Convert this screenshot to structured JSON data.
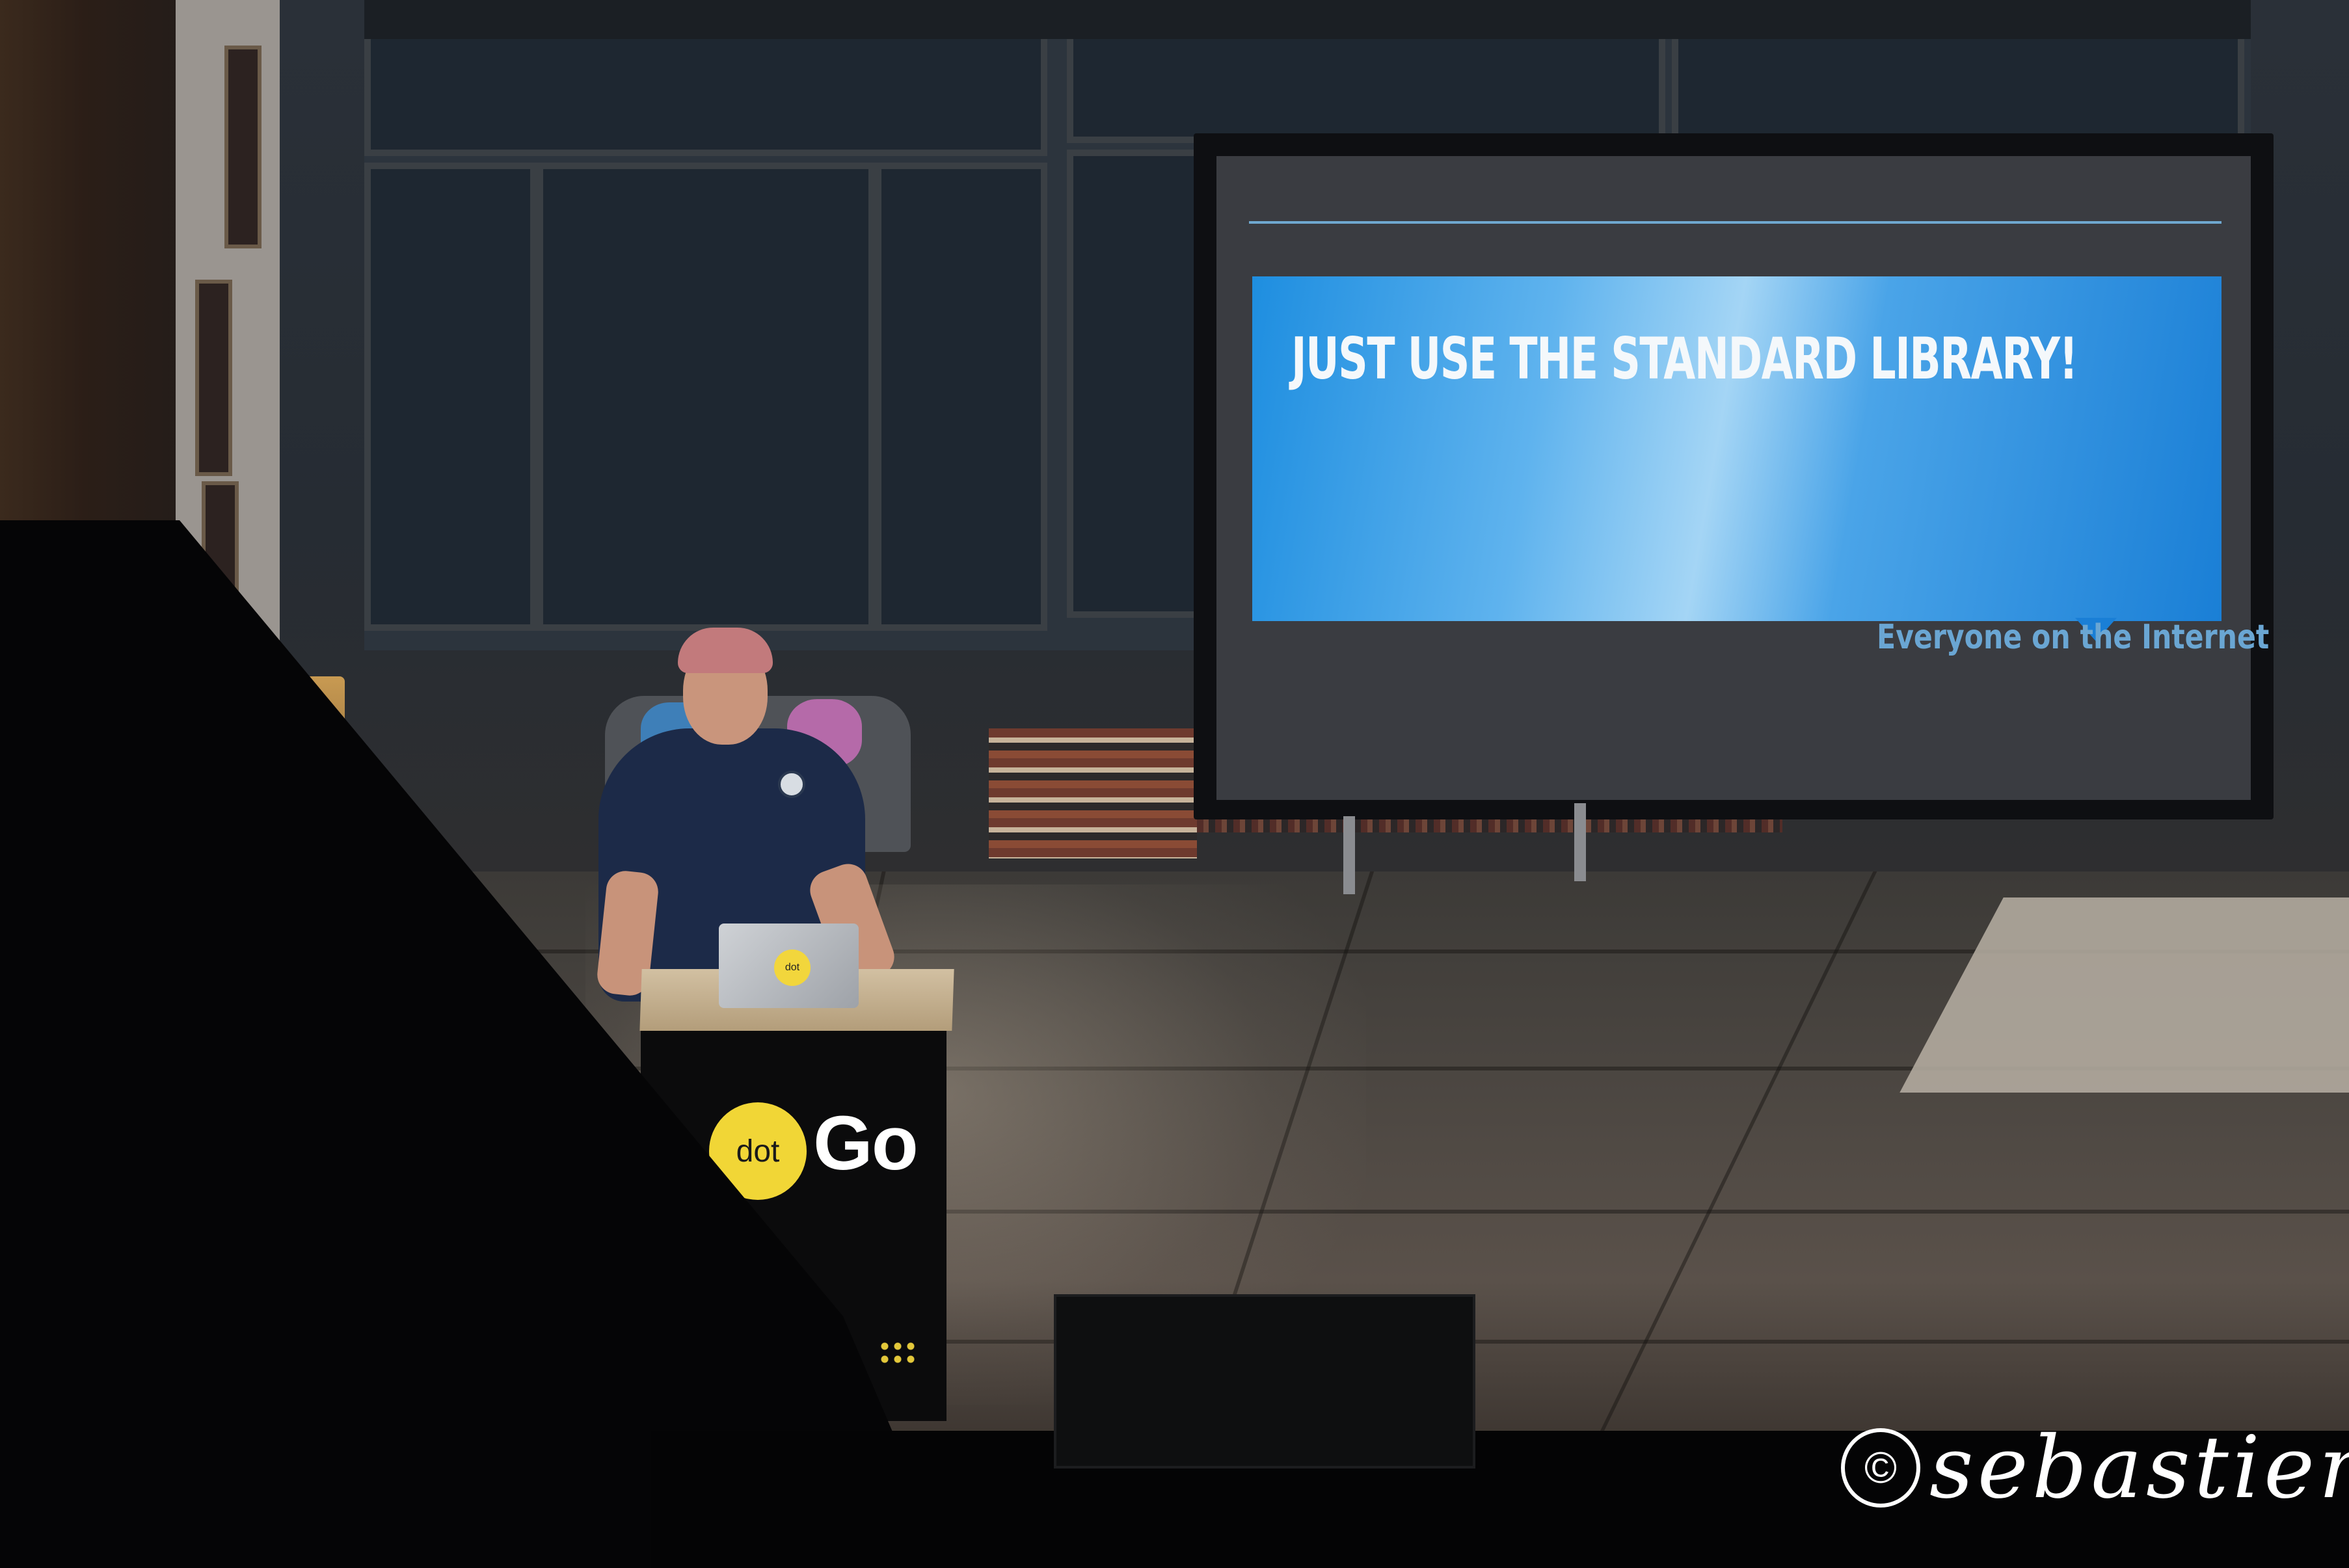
{
  "slide": {
    "headline": "JUST USE THE STANDARD LIBRARY!",
    "attribution": "Everyone on the Internet"
  },
  "podium": {
    "logo_dot": "dot",
    "logo_go": "Go",
    "laptop_sticker": "dot"
  },
  "watermark": {
    "symbol": "©",
    "text": "sebastienfr"
  },
  "colors": {
    "slide_blue": "#1e8ee0",
    "slide_light_blue": "#a4d5f5",
    "attribution_blue": "#6aa6d3",
    "logo_yellow": "#f1d636",
    "podium_black": "#0b0b0c"
  }
}
